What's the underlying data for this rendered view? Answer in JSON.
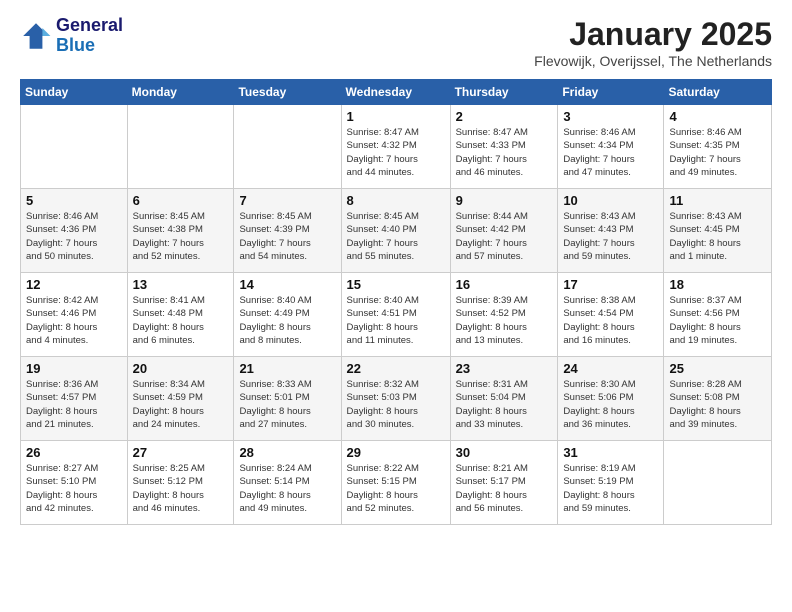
{
  "header": {
    "logo_line1": "General",
    "logo_line2": "Blue",
    "title": "January 2025",
    "subtitle": "Flevowijk, Overijssel, The Netherlands"
  },
  "days_of_week": [
    "Sunday",
    "Monday",
    "Tuesday",
    "Wednesday",
    "Thursday",
    "Friday",
    "Saturday"
  ],
  "weeks": [
    [
      {
        "day": "",
        "info": ""
      },
      {
        "day": "",
        "info": ""
      },
      {
        "day": "",
        "info": ""
      },
      {
        "day": "1",
        "info": "Sunrise: 8:47 AM\nSunset: 4:32 PM\nDaylight: 7 hours\nand 44 minutes."
      },
      {
        "day": "2",
        "info": "Sunrise: 8:47 AM\nSunset: 4:33 PM\nDaylight: 7 hours\nand 46 minutes."
      },
      {
        "day": "3",
        "info": "Sunrise: 8:46 AM\nSunset: 4:34 PM\nDaylight: 7 hours\nand 47 minutes."
      },
      {
        "day": "4",
        "info": "Sunrise: 8:46 AM\nSunset: 4:35 PM\nDaylight: 7 hours\nand 49 minutes."
      }
    ],
    [
      {
        "day": "5",
        "info": "Sunrise: 8:46 AM\nSunset: 4:36 PM\nDaylight: 7 hours\nand 50 minutes."
      },
      {
        "day": "6",
        "info": "Sunrise: 8:45 AM\nSunset: 4:38 PM\nDaylight: 7 hours\nand 52 minutes."
      },
      {
        "day": "7",
        "info": "Sunrise: 8:45 AM\nSunset: 4:39 PM\nDaylight: 7 hours\nand 54 minutes."
      },
      {
        "day": "8",
        "info": "Sunrise: 8:45 AM\nSunset: 4:40 PM\nDaylight: 7 hours\nand 55 minutes."
      },
      {
        "day": "9",
        "info": "Sunrise: 8:44 AM\nSunset: 4:42 PM\nDaylight: 7 hours\nand 57 minutes."
      },
      {
        "day": "10",
        "info": "Sunrise: 8:43 AM\nSunset: 4:43 PM\nDaylight: 7 hours\nand 59 minutes."
      },
      {
        "day": "11",
        "info": "Sunrise: 8:43 AM\nSunset: 4:45 PM\nDaylight: 8 hours\nand 1 minute."
      }
    ],
    [
      {
        "day": "12",
        "info": "Sunrise: 8:42 AM\nSunset: 4:46 PM\nDaylight: 8 hours\nand 4 minutes."
      },
      {
        "day": "13",
        "info": "Sunrise: 8:41 AM\nSunset: 4:48 PM\nDaylight: 8 hours\nand 6 minutes."
      },
      {
        "day": "14",
        "info": "Sunrise: 8:40 AM\nSunset: 4:49 PM\nDaylight: 8 hours\nand 8 minutes."
      },
      {
        "day": "15",
        "info": "Sunrise: 8:40 AM\nSunset: 4:51 PM\nDaylight: 8 hours\nand 11 minutes."
      },
      {
        "day": "16",
        "info": "Sunrise: 8:39 AM\nSunset: 4:52 PM\nDaylight: 8 hours\nand 13 minutes."
      },
      {
        "day": "17",
        "info": "Sunrise: 8:38 AM\nSunset: 4:54 PM\nDaylight: 8 hours\nand 16 minutes."
      },
      {
        "day": "18",
        "info": "Sunrise: 8:37 AM\nSunset: 4:56 PM\nDaylight: 8 hours\nand 19 minutes."
      }
    ],
    [
      {
        "day": "19",
        "info": "Sunrise: 8:36 AM\nSunset: 4:57 PM\nDaylight: 8 hours\nand 21 minutes."
      },
      {
        "day": "20",
        "info": "Sunrise: 8:34 AM\nSunset: 4:59 PM\nDaylight: 8 hours\nand 24 minutes."
      },
      {
        "day": "21",
        "info": "Sunrise: 8:33 AM\nSunset: 5:01 PM\nDaylight: 8 hours\nand 27 minutes."
      },
      {
        "day": "22",
        "info": "Sunrise: 8:32 AM\nSunset: 5:03 PM\nDaylight: 8 hours\nand 30 minutes."
      },
      {
        "day": "23",
        "info": "Sunrise: 8:31 AM\nSunset: 5:04 PM\nDaylight: 8 hours\nand 33 minutes."
      },
      {
        "day": "24",
        "info": "Sunrise: 8:30 AM\nSunset: 5:06 PM\nDaylight: 8 hours\nand 36 minutes."
      },
      {
        "day": "25",
        "info": "Sunrise: 8:28 AM\nSunset: 5:08 PM\nDaylight: 8 hours\nand 39 minutes."
      }
    ],
    [
      {
        "day": "26",
        "info": "Sunrise: 8:27 AM\nSunset: 5:10 PM\nDaylight: 8 hours\nand 42 minutes."
      },
      {
        "day": "27",
        "info": "Sunrise: 8:25 AM\nSunset: 5:12 PM\nDaylight: 8 hours\nand 46 minutes."
      },
      {
        "day": "28",
        "info": "Sunrise: 8:24 AM\nSunset: 5:14 PM\nDaylight: 8 hours\nand 49 minutes."
      },
      {
        "day": "29",
        "info": "Sunrise: 8:22 AM\nSunset: 5:15 PM\nDaylight: 8 hours\nand 52 minutes."
      },
      {
        "day": "30",
        "info": "Sunrise: 8:21 AM\nSunset: 5:17 PM\nDaylight: 8 hours\nand 56 minutes."
      },
      {
        "day": "31",
        "info": "Sunrise: 8:19 AM\nSunset: 5:19 PM\nDaylight: 8 hours\nand 59 minutes."
      },
      {
        "day": "",
        "info": ""
      }
    ]
  ]
}
